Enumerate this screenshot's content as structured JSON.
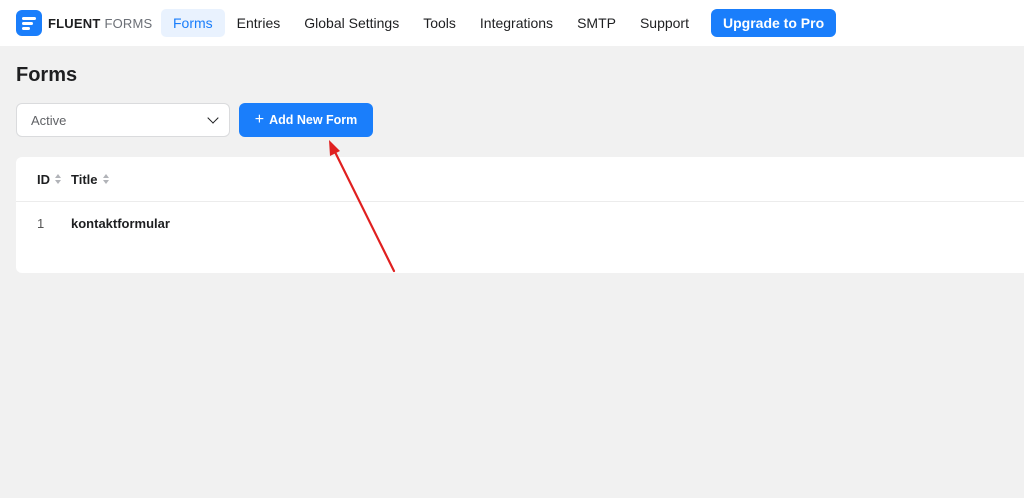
{
  "app": {
    "logo_primary": "FLUENT",
    "logo_secondary": "FORMS"
  },
  "nav": {
    "items": [
      {
        "label": "Forms",
        "active": true
      },
      {
        "label": "Entries",
        "active": false
      },
      {
        "label": "Global Settings",
        "active": false
      },
      {
        "label": "Tools",
        "active": false
      },
      {
        "label": "Integrations",
        "active": false
      },
      {
        "label": "SMTP",
        "active": false
      },
      {
        "label": "Support",
        "active": false
      }
    ],
    "upgrade_label": "Upgrade to Pro"
  },
  "page": {
    "title": "Forms"
  },
  "filter": {
    "selected": "Active",
    "icon": "chevron-down-icon"
  },
  "actions": {
    "add_icon": "plus-icon",
    "add_label": "Add New Form"
  },
  "table": {
    "columns": [
      "ID",
      "Title"
    ],
    "rows": [
      {
        "id": "1",
        "title": "kontaktformular"
      }
    ]
  },
  "annotation": {
    "arrow_color": "#e02020"
  },
  "colors": {
    "accent": "#1a7efb",
    "background": "#f1f1f1"
  }
}
